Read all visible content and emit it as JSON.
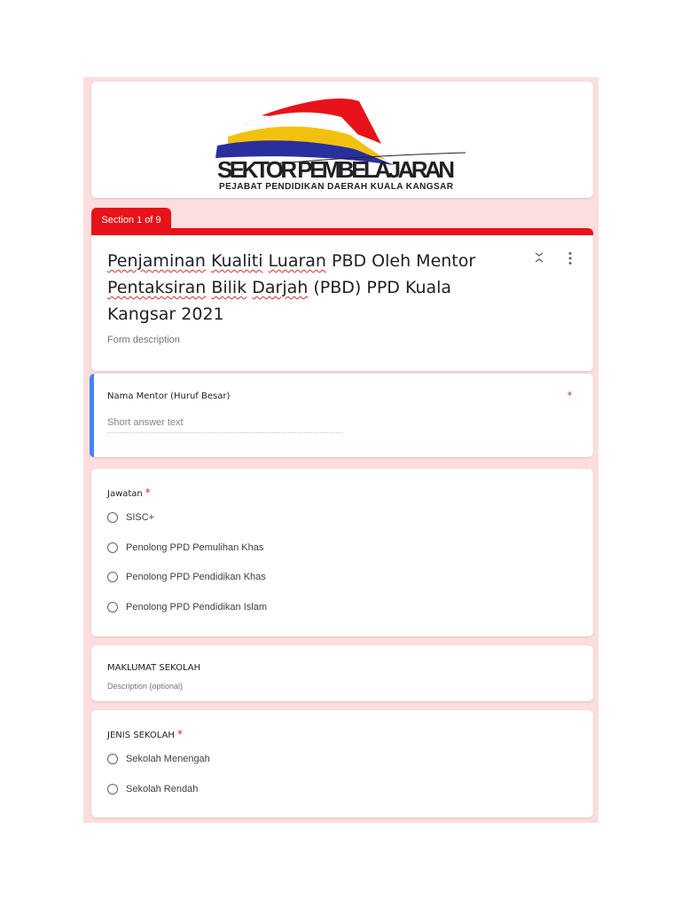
{
  "logo": {
    "title": "SEKTOR PEMBELAJARAN",
    "subtitle": "PEJABAT PENDIDIKAN DAERAH KUALA KANGSAR"
  },
  "section_tab": "Section 1 of 9",
  "form": {
    "title_parts": [
      "Penjaminan",
      " ",
      "Kualiti",
      " ",
      "Luaran",
      " PBD Oleh Mentor ",
      "Pentaksiran",
      " ",
      "Bilik",
      " ",
      "Darjah",
      " (PBD) PPD Kuala Kangsar 2021"
    ],
    "description": "Form description"
  },
  "questions": [
    {
      "label": "Nama Mentor (Huruf Besar)",
      "required_mark": "*",
      "placeholder": "Short answer text"
    },
    {
      "label": "Jawatan",
      "required_mark": "*",
      "options": [
        "SISC+",
        "Penolong PPD Pemulihan Khas",
        "Penolong PPD Pendidikan Khas",
        "Penolong PPD Pendidikan Islam"
      ]
    },
    {
      "label": "JENIS SEKOLAH",
      "required_mark": "*",
      "options": [
        "Sekolah Menengah",
        "Sekolah Rendah"
      ]
    }
  ],
  "section_block": {
    "title": "MAKLUMAT SEKOLAH",
    "description": "Description (optional)"
  },
  "colors": {
    "theme_red": "#e8121a",
    "background_pink": "#fbdedd",
    "active_blue": "#4285f4"
  }
}
